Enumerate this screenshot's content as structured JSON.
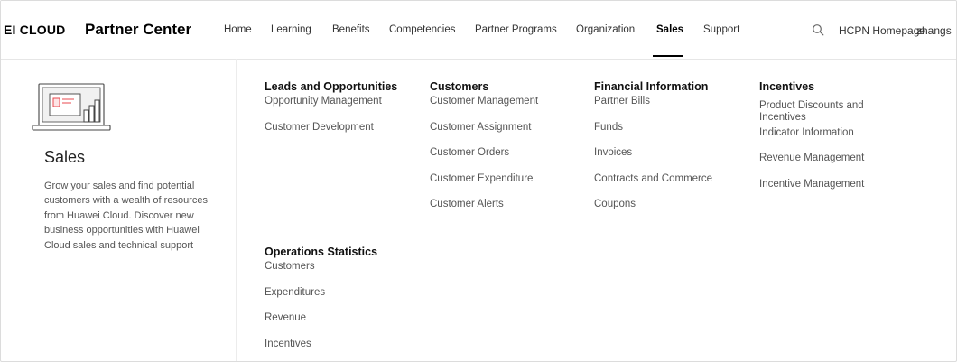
{
  "header": {
    "brand": "EI CLOUD",
    "product": "Partner Center",
    "nav": [
      "Home",
      "Learning",
      "Benefits",
      "Competencies",
      "Partner Programs",
      "Organization",
      "Sales",
      "Support"
    ],
    "active_nav": "Sales",
    "hcpn_link": "HCPN Homepage",
    "user": "zhangs"
  },
  "intro": {
    "icon": "sales-chart-monitor-icon",
    "title": "Sales",
    "description": "Grow your sales and find potential customers with a wealth of resources from Huawei Cloud. Discover new business opportunities with Huawei Cloud sales and technical support"
  },
  "menu": {
    "leads": {
      "title": "Leads and Opportunities",
      "items": [
        "Opportunity Management",
        "Customer Development"
      ]
    },
    "customers": {
      "title": "Customers",
      "items": [
        "Customer Management",
        "Customer Assignment",
        "Customer Orders",
        "Customer Expenditure",
        "Customer Alerts"
      ]
    },
    "financial": {
      "title": "Financial Information",
      "items": [
        "Partner Bills",
        "Funds",
        "Invoices",
        "Contracts and Commerce",
        "Coupons"
      ]
    },
    "incentives": {
      "title": "Incentives",
      "items": [
        "Product Discounts and Incentives",
        "Indicator Information",
        "Revenue Management",
        "Incentive Management"
      ]
    },
    "operations": {
      "title": "Operations Statistics",
      "items": [
        "Customers",
        "Expenditures",
        "Revenue",
        "Incentives"
      ]
    }
  },
  "colors": {
    "accent_red": "#e8484f",
    "heading": "#111111",
    "text": "#555555",
    "nav_underline": "#000000"
  }
}
